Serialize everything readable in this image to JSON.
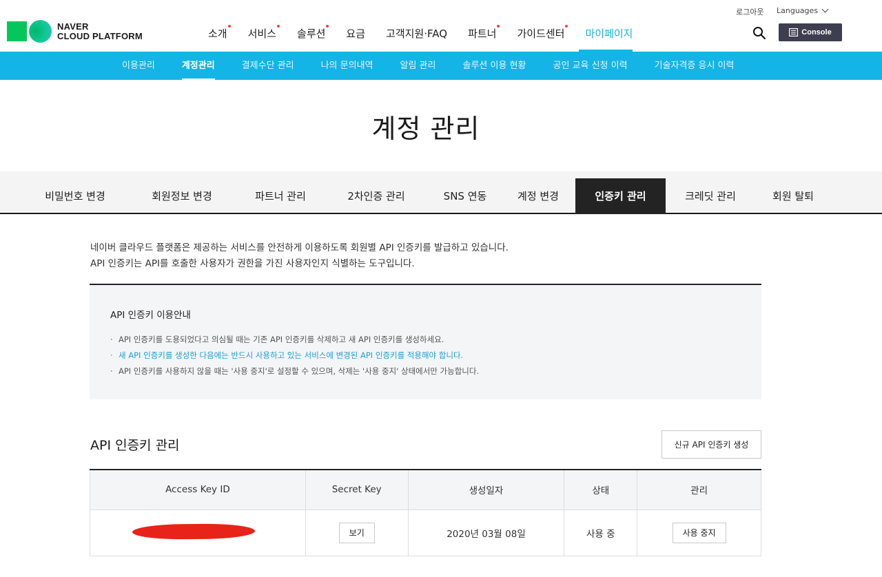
{
  "header": {
    "logo_line1": "NAVER",
    "logo_line2": "CLOUD PLATFORM",
    "logout": "로그아웃",
    "languages": "Languages",
    "console": "Console",
    "gnb": [
      {
        "label": "소개",
        "dot": true
      },
      {
        "label": "서비스",
        "dot": true
      },
      {
        "label": "솔루션",
        "dot": true
      },
      {
        "label": "요금",
        "dot": false
      },
      {
        "label": "고객지원·FAQ",
        "dot": false
      },
      {
        "label": "파트너",
        "dot": true
      },
      {
        "label": "가이드센터",
        "dot": true
      },
      {
        "label": "마이페이지",
        "dot": false,
        "active": true
      }
    ]
  },
  "subnav": [
    {
      "label": "이용관리"
    },
    {
      "label": "계정관리",
      "active": true
    },
    {
      "label": "결제수단 관리"
    },
    {
      "label": "나의 문의내역"
    },
    {
      "label": "알림 관리"
    },
    {
      "label": "솔루션 이용 현황"
    },
    {
      "label": "공인 교육 신청 이력"
    },
    {
      "label": "기술자격증 응시 이력"
    }
  ],
  "page_title": "계정 관리",
  "tabs": [
    {
      "label": "비밀번호 변경"
    },
    {
      "label": "회원정보 변경"
    },
    {
      "label": "파트너 관리"
    },
    {
      "label": "2차인증 관리"
    },
    {
      "label": "SNS 연동"
    },
    {
      "label": "계정 변경"
    },
    {
      "label": "인증키 관리",
      "active": true
    },
    {
      "label": "크레딧 관리"
    },
    {
      "label": "회원 탈퇴"
    }
  ],
  "intro": {
    "line1": "네이버 클라우드 플랫폼은 제공하는 서비스를 안전하게 이용하도록 회원별 API 인증키를 발급하고 있습니다.",
    "line2": "API 인증키는 API를 호출한 사용자가 권한을 가진 사용자인지 식별하는 도구입니다."
  },
  "notice": {
    "title": "API 인증키 이용안내",
    "items": [
      "API 인증키를 도용되었다고 의심될 때는 기존 API 인증키를 삭제하고 새 API 인증키를 생성하세요.",
      "새 API 인증키를 생성한 다음에는 반드시 사용하고 있는 서비스에 변경된 API 인증키를 적용해야 합니다.",
      "API 인증키를 사용하지 않을 때는 '사용 중지'로 설정할 수 있으며, 삭제는 '사용 중지' 상태에서만 가능합니다."
    ],
    "highlight_color": "#1c9fd6"
  },
  "keys_section": {
    "title": "API 인증키 관리",
    "create_button": "신규 API 인증키 생성",
    "columns": [
      "Access Key ID",
      "Secret Key",
      "생성일자",
      "상태",
      "관리"
    ],
    "rows": [
      {
        "access_key": "",
        "secret_button": "보기",
        "created": "2020년 03월 08일",
        "status": "사용 중",
        "action_button": "사용 중지"
      }
    ]
  },
  "colors": {
    "accent": "#14b4e6",
    "console_bg": "#3d3f50",
    "active_tab_bg": "#232323",
    "redaction": "#e8231a"
  },
  "icons": {
    "search": "search-icon",
    "console": "console-icon",
    "languages": "chevron-down-icon"
  }
}
